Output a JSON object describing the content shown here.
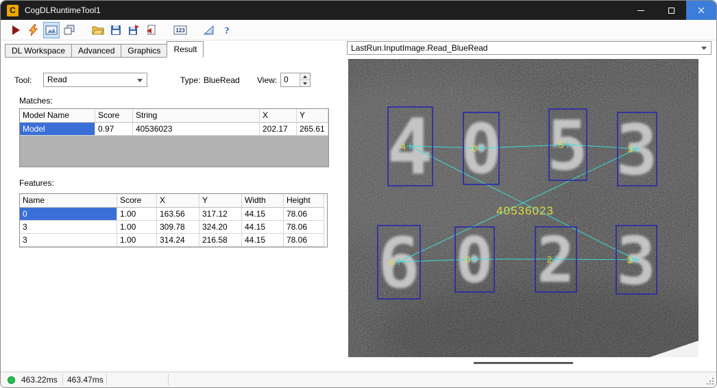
{
  "window": {
    "title": "CogDLRuntimeTool1",
    "logo": "C"
  },
  "toolbar": {
    "numbers_icon_label": "123",
    "help_label": "?"
  },
  "tabs": [
    {
      "label": "DL Workspace"
    },
    {
      "label": "Advanced"
    },
    {
      "label": "Graphics"
    },
    {
      "label": "Result"
    }
  ],
  "result": {
    "tool_label": "Tool:",
    "tool_value": "Read",
    "type_label": "Type:",
    "type_value": "BlueRead",
    "view_label": "View:",
    "view_value": "0",
    "matches_label": "Matches:",
    "matches": {
      "columns": [
        "Model Name",
        "Score",
        "String",
        "X",
        "Y"
      ],
      "rows": [
        [
          "Model",
          "0.97",
          "40536023",
          "202.17",
          "265.61"
        ]
      ]
    },
    "features_label": "Features:",
    "features": {
      "columns": [
        "Name",
        "Score",
        "X",
        "Y",
        "Width",
        "Height"
      ],
      "rows": [
        [
          "0",
          "1.00",
          "163.56",
          "317.12",
          "44.15",
          "78.06"
        ],
        [
          "3",
          "1.00",
          "309.78",
          "324.20",
          "44.15",
          "78.06"
        ],
        [
          "3",
          "1.00",
          "314.24",
          "216.58",
          "44.15",
          "78.06"
        ]
      ]
    }
  },
  "image_panel": {
    "source": "LastRun.InputImage.Read_BlueRead",
    "match_string": "40536023",
    "digit_labels": [
      "4",
      "0",
      "5",
      "3",
      "6",
      "0",
      "2",
      "3"
    ]
  },
  "statusbar": {
    "time1": "463.22ms",
    "time2": "463.47ms"
  },
  "colors": {
    "selection": "#3a6fd8",
    "overlay_box": "#2222b2",
    "overlay_line": "#3ae0e0",
    "overlay_label": "#e0e040"
  }
}
